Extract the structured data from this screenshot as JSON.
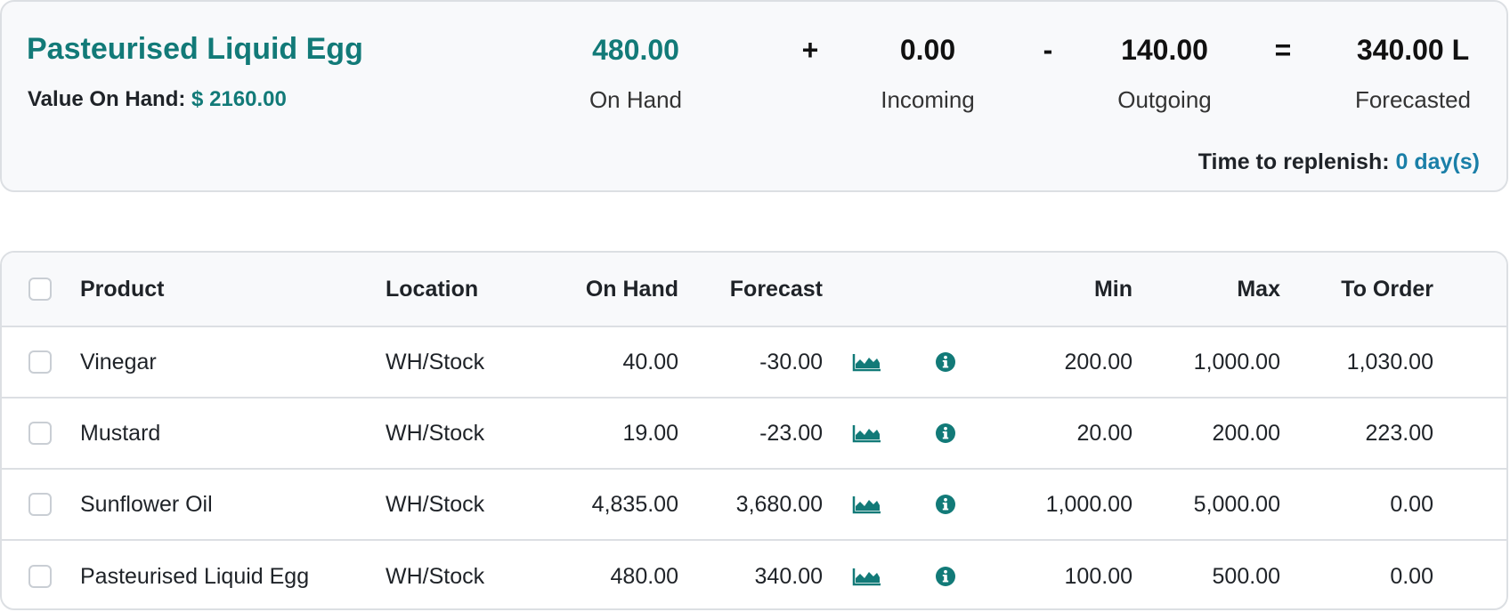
{
  "summary": {
    "product_name": "Pasteurised Liquid Egg",
    "value_label": "Value On Hand:",
    "value_amount": "$ 2160.00",
    "metrics": {
      "on_hand": {
        "value": "480.00",
        "label": "On Hand"
      },
      "incoming": {
        "value": "0.00",
        "label": "Incoming"
      },
      "outgoing": {
        "value": "140.00",
        "label": "Outgoing"
      },
      "forecasted": {
        "value": "340.00 L",
        "label": "Forecasted"
      }
    },
    "operators": {
      "plus": "+",
      "minus": "-",
      "equals": "="
    },
    "replenish_label": "Time to replenish:",
    "replenish_value": "0 day(s)"
  },
  "table": {
    "columns": {
      "product": "Product",
      "location": "Location",
      "on_hand": "On Hand",
      "forecast": "Forecast",
      "min": "Min",
      "max": "Max",
      "to_order": "To Order"
    },
    "rows": [
      {
        "product": "Vinegar",
        "location": "WH/Stock",
        "on_hand": "40.00",
        "forecast": "-30.00",
        "min": "200.00",
        "max": "1,000.00",
        "to_order": "1,030.00"
      },
      {
        "product": "Mustard",
        "location": "WH/Stock",
        "on_hand": "19.00",
        "forecast": "-23.00",
        "min": "20.00",
        "max": "200.00",
        "to_order": "223.00"
      },
      {
        "product": "Sunflower Oil",
        "location": "WH/Stock",
        "on_hand": "4,835.00",
        "forecast": "3,680.00",
        "min": "1,000.00",
        "max": "5,000.00",
        "to_order": "0.00"
      },
      {
        "product": "Pasteurised Liquid Egg",
        "location": "WH/Stock",
        "on_hand": "480.00",
        "forecast": "340.00",
        "min": "100.00",
        "max": "500.00",
        "to_order": "0.00"
      }
    ],
    "row_icons": {
      "chart": "area-chart-icon",
      "info": "info-circle-icon"
    }
  },
  "colors": {
    "accent": "#127a78",
    "link": "#1a7fa8",
    "border": "#dcdfe3",
    "header_bg": "#f8f9fb"
  }
}
